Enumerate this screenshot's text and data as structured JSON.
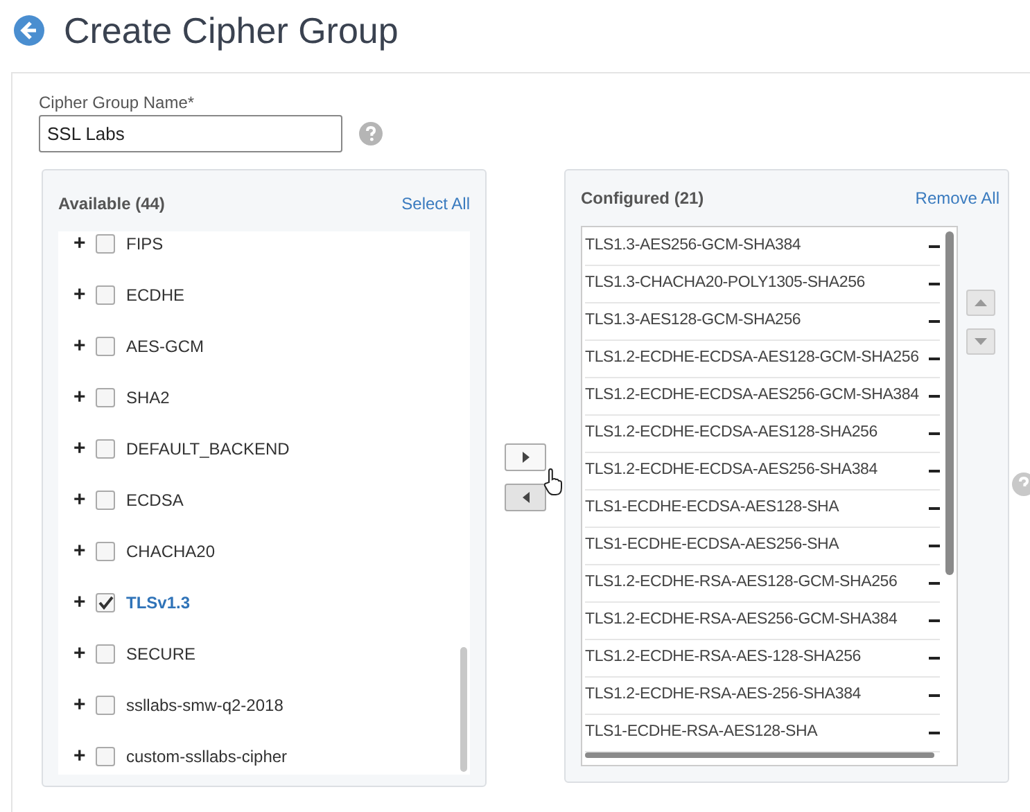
{
  "page": {
    "title": "Create Cipher Group"
  },
  "name_field": {
    "label": "Cipher Group Name*",
    "value": "SSL Labs"
  },
  "available": {
    "title": "Available (44)",
    "action": "Select All",
    "items": [
      {
        "label": "FIPS",
        "checked": false,
        "expand": "+"
      },
      {
        "label": "ECDHE",
        "checked": false,
        "expand": "+"
      },
      {
        "label": "AES-GCM",
        "checked": false,
        "expand": "+"
      },
      {
        "label": "SHA2",
        "checked": false,
        "expand": "+"
      },
      {
        "label": "DEFAULT_BACKEND",
        "checked": false,
        "expand": "+"
      },
      {
        "label": "ECDSA",
        "checked": false,
        "expand": "+"
      },
      {
        "label": "CHACHA20",
        "checked": false,
        "expand": "+"
      },
      {
        "label": "TLSv1.3",
        "checked": true,
        "expand": "+"
      },
      {
        "label": "SECURE",
        "checked": false,
        "expand": "+"
      },
      {
        "label": "ssllabs-smw-q2-2018",
        "checked": false,
        "expand": "+"
      },
      {
        "label": "custom-ssllabs-cipher",
        "checked": false,
        "expand": "+"
      }
    ]
  },
  "configured": {
    "title": "Configured (21)",
    "action": "Remove All",
    "items": [
      "TLS1.3-AES256-GCM-SHA384",
      "TLS1.3-CHACHA20-POLY1305-SHA256",
      "TLS1.3-AES128-GCM-SHA256",
      "TLS1.2-ECDHE-ECDSA-AES128-GCM-SHA256",
      "TLS1.2-ECDHE-ECDSA-AES256-GCM-SHA384",
      "TLS1.2-ECDHE-ECDSA-AES128-SHA256",
      "TLS1.2-ECDHE-ECDSA-AES256-SHA384",
      "TLS1-ECDHE-ECDSA-AES128-SHA",
      "TLS1-ECDHE-ECDSA-AES256-SHA",
      "TLS1.2-ECDHE-RSA-AES128-GCM-SHA256",
      "TLS1.2-ECDHE-RSA-AES256-GCM-SHA384",
      "TLS1.2-ECDHE-RSA-AES-128-SHA256",
      "TLS1.2-ECDHE-RSA-AES-256-SHA384",
      "TLS1-ECDHE-RSA-AES128-SHA"
    ]
  }
}
